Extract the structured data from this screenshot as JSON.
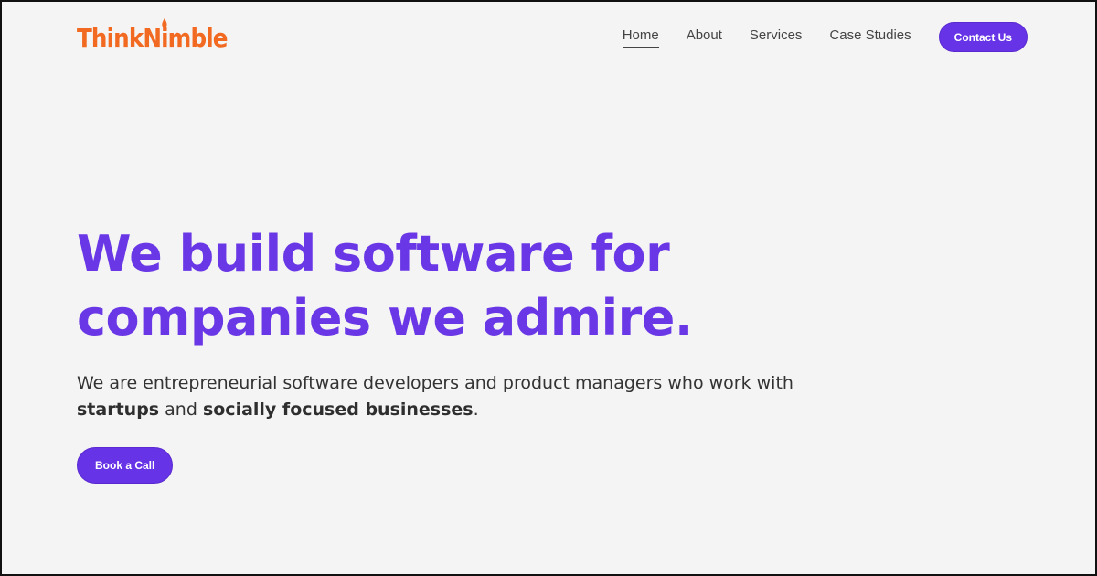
{
  "brand": {
    "logo_prefix": "ThinkN",
    "logo_tip_letter": "i",
    "logo_suffix": "mble",
    "color": "#f26a21"
  },
  "nav": {
    "items": [
      {
        "label": "Home",
        "active": true
      },
      {
        "label": "About",
        "active": false
      },
      {
        "label": "Services",
        "active": false
      },
      {
        "label": "Case Studies",
        "active": false
      }
    ],
    "cta_label": "Contact Us"
  },
  "hero": {
    "headline_line1": "We build software for",
    "headline_line2": "companies we admire.",
    "sub_part1": "We are entrepreneurial software developers and product managers who work with ",
    "sub_bold1": "startups",
    "sub_part2": " and ",
    "sub_bold2": "socially focused businesses",
    "sub_part3": ".",
    "cta_label": "Book a Call"
  },
  "colors": {
    "accent": "#6633e6",
    "headline": "#6a37e6",
    "background": "#f4f4f4"
  }
}
